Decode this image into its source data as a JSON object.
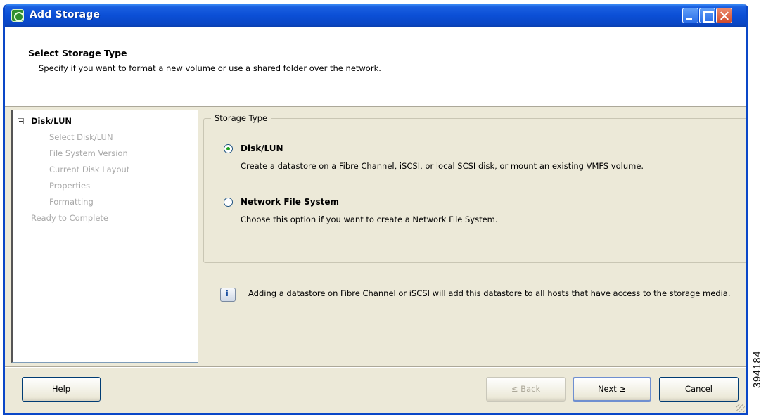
{
  "window": {
    "title": "Add Storage",
    "icon": "add-storage-icon",
    "controls": [
      "minimize-icon",
      "maximize-icon",
      "close-icon"
    ]
  },
  "header": {
    "title": "Select Storage Type",
    "subtitle": "Specify if you want to format a new volume or use a shared folder over the network."
  },
  "nav": {
    "items": [
      {
        "label": "Disk/LUN",
        "level": 0,
        "state": "current"
      },
      {
        "label": "Select Disk/LUN",
        "level": 1,
        "state": "disabled"
      },
      {
        "label": "File System Version",
        "level": 1,
        "state": "disabled"
      },
      {
        "label": "Current Disk Layout",
        "level": 1,
        "state": "disabled"
      },
      {
        "label": "Properties",
        "level": 1,
        "state": "disabled"
      },
      {
        "label": "Formatting",
        "level": 1,
        "state": "disabled"
      },
      {
        "label": "Ready to Complete",
        "level": 0,
        "state": "disabled"
      }
    ]
  },
  "storage_type": {
    "group_label": "Storage Type",
    "options": [
      {
        "label": "Disk/LUN",
        "description": "Create a datastore on a Fibre Channel, iSCSI, or local SCSI disk, or mount an existing VMFS volume.",
        "selected": true
      },
      {
        "label": "Network File System",
        "description": "Choose this option if you want to create a Network File System.",
        "selected": false
      }
    ]
  },
  "info": {
    "text": "Adding a datastore on Fibre Channel or iSCSI will add this datastore to all hosts that have access to the storage media."
  },
  "buttons": {
    "help": "Help",
    "back": "≤ Back",
    "next": "Next ≥",
    "cancel": "Cancel"
  },
  "side_id": "394184",
  "colors": {
    "titlebar": "#0b4fd6",
    "dialog_bg": "#ece9d8",
    "disabled_text": "#a8a8a8"
  }
}
